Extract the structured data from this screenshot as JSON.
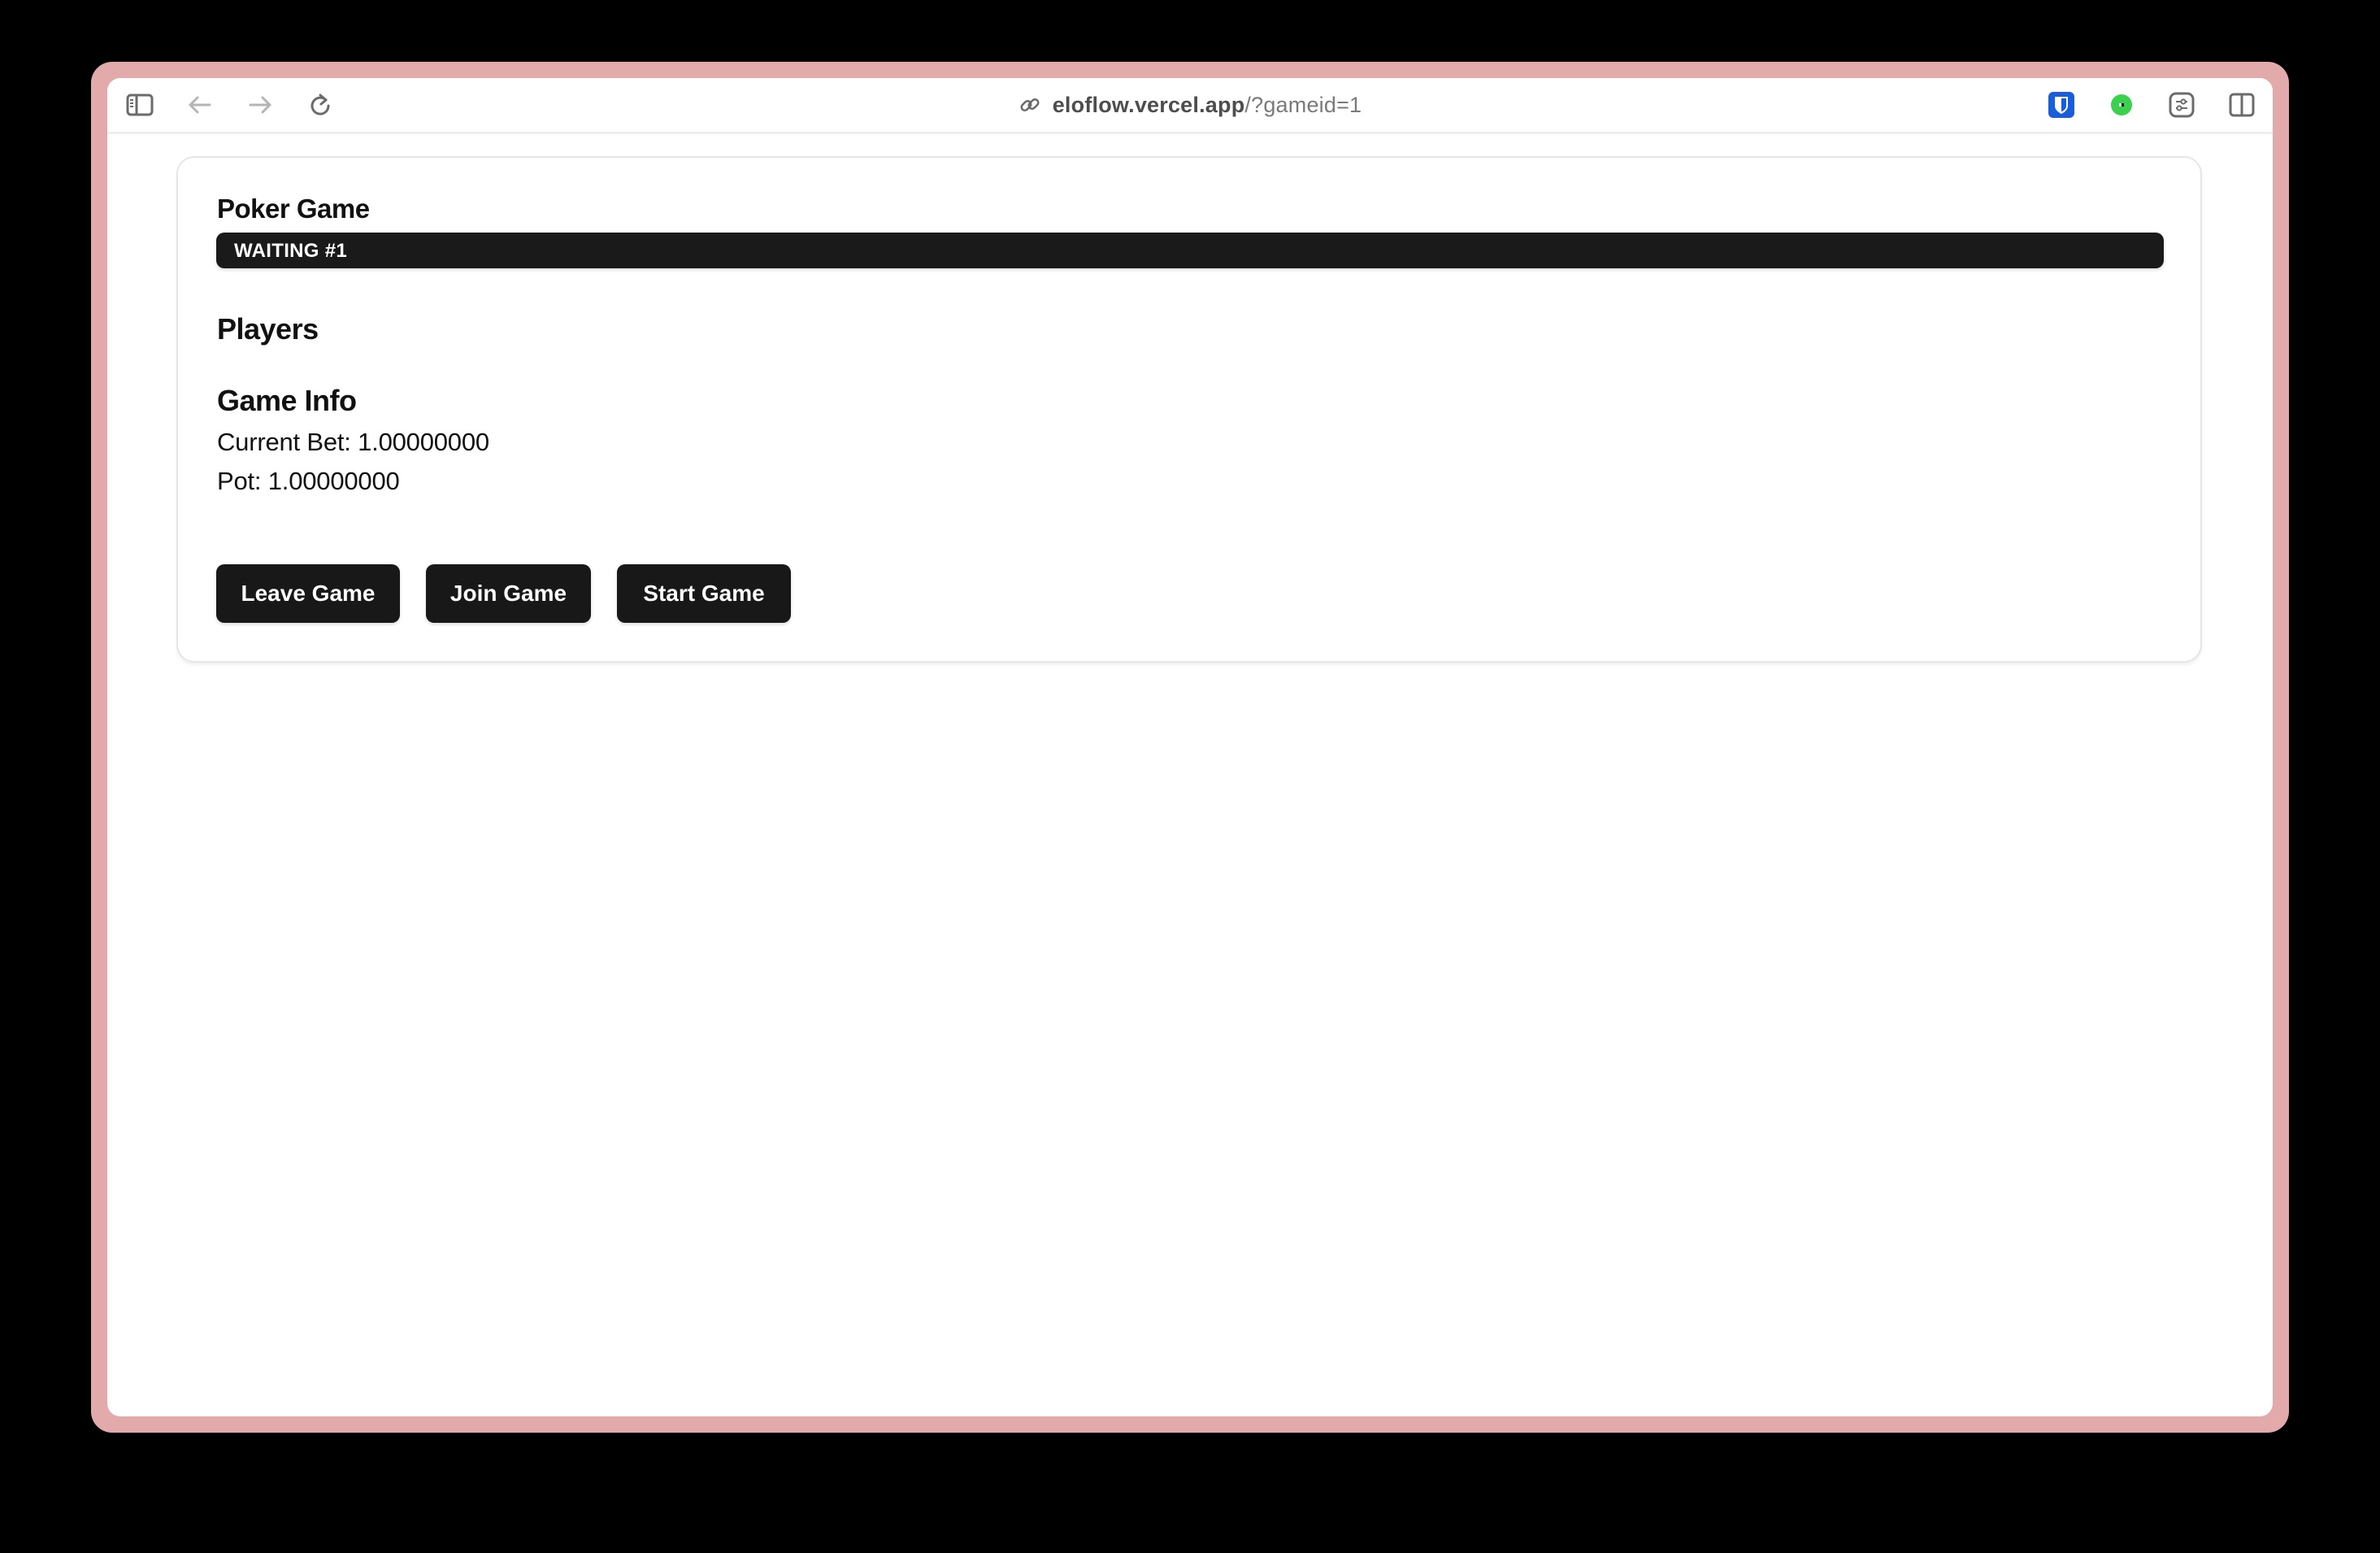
{
  "browser": {
    "url_host": "eloflow.vercel.app",
    "url_path": "/?gameid=1",
    "toolbar_icons": {
      "sidebar": "sidebar-icon",
      "back": "back-arrow-icon",
      "forward": "forward-arrow-icon",
      "reload": "reload-icon",
      "link": "link-icon",
      "bitwarden": "bitwarden-shield-icon",
      "extension": "green-dot-extension-icon",
      "settings": "sliders-icon",
      "split_view": "split-view-icon"
    },
    "colors": {
      "frame": "#e2aaaa",
      "bitwarden": "#175ddc",
      "extension_green": "#3ad14f"
    }
  },
  "game": {
    "title": "Poker Game",
    "status": "WAITING #1",
    "players_heading": "Players",
    "players": [],
    "info_heading": "Game Info",
    "current_bet_label": "Current Bet: 1.00000000",
    "pot_label": "Pot: 1.00000000",
    "current_bet": "1.00000000",
    "pot": "1.00000000"
  },
  "actions": {
    "leave": "Leave Game",
    "join": "Join Game",
    "start": "Start Game"
  }
}
